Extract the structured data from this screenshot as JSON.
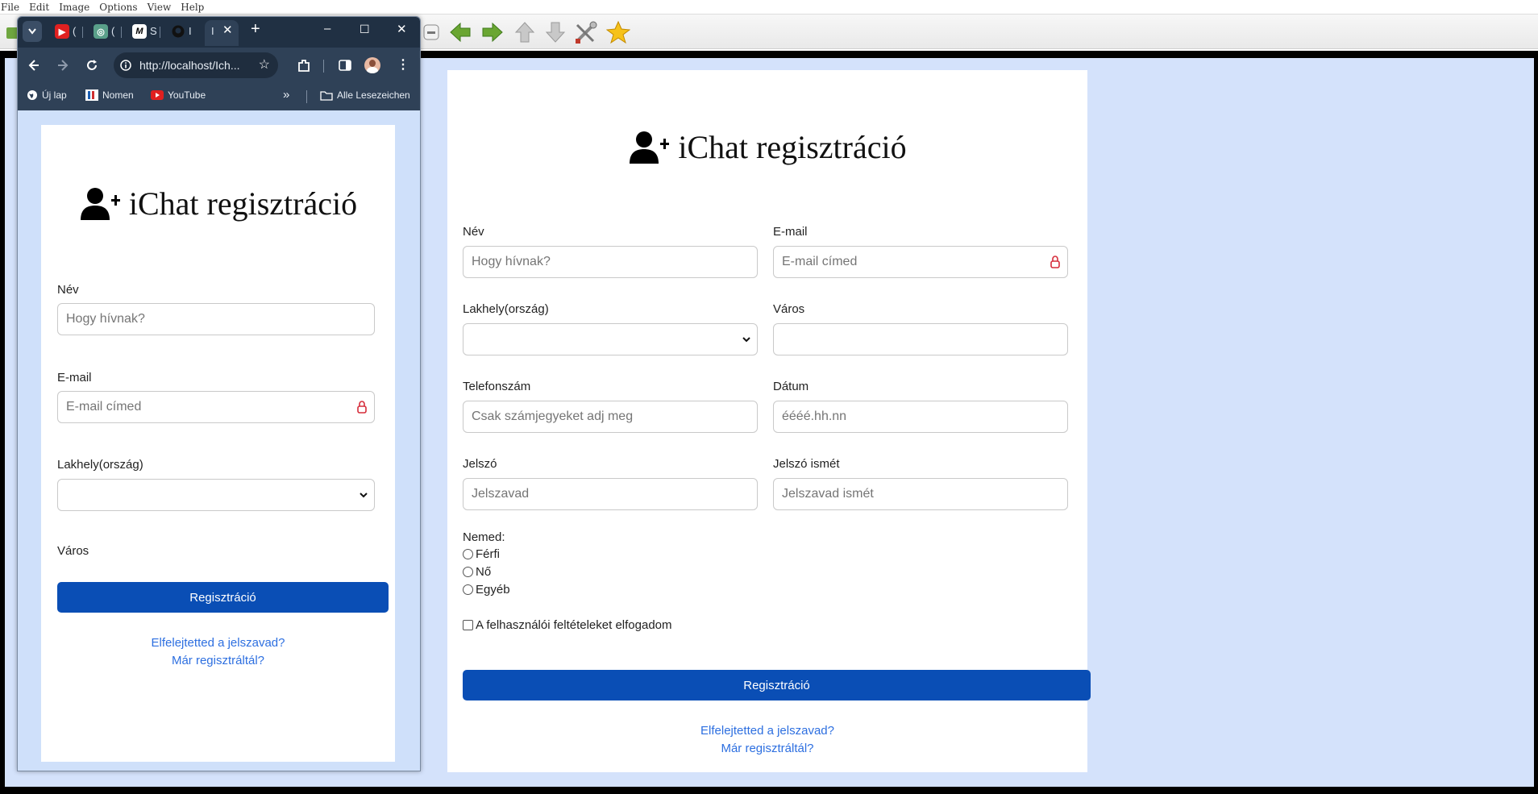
{
  "menu": [
    "File",
    "Edit",
    "Image",
    "Options",
    "View",
    "Help"
  ],
  "toolbar_icons": [
    "minimize-icon",
    "arrow-left-icon",
    "arrow-right-icon",
    "arrow-up-icon",
    "arrow-down-icon",
    "tools-icon",
    "star-icon"
  ],
  "colors": {
    "page_bg": "#d4e2fb",
    "button_bg": "#0a4eb5",
    "link": "#2d6fe0",
    "browser_chrome": "#2f4157",
    "tab_strip": "#203043"
  },
  "form": {
    "title": "iChat regisztráció",
    "name_label": "Név",
    "name_placeholder": "Hogy hívnak?",
    "email_label": "E-mail",
    "email_placeholder": "E-mail címed",
    "country_label": "Lakhely(ország)",
    "country_value": "",
    "city_label": "Város",
    "city_value": "",
    "phone_label": "Telefonszám",
    "phone_placeholder": "Csak számjegyeket adj meg",
    "date_label": "Dátum",
    "date_placeholder": "éééé.hh.nn",
    "password_label": "Jelszó",
    "password_placeholder": "Jelszavad",
    "password2_label": "Jelszó ismét",
    "password2_placeholder": "Jelszavad ismét",
    "gender_label": "Nemed:",
    "gender_options": [
      "Férfi",
      "Nő",
      "Egyéb"
    ],
    "terms_label": "A felhasználói feltételeket elfogadom",
    "submit_label": "Regisztráció",
    "forgot_link": "Elfelejtetted a jelszavad?",
    "already_link": "Már regisztráltál?"
  },
  "browser": {
    "tab_labels": [
      "(",
      "(",
      "S",
      "I",
      "I"
    ],
    "new_tab": "+",
    "window_controls": [
      "–",
      "☐",
      "✕"
    ],
    "url": "http://localhost/Ich...",
    "bookmarks": [
      "Új lap",
      "Nomen",
      "YouTube"
    ],
    "bookmarks_more": "»",
    "all_bookmarks": "Alle Lesezeichen"
  }
}
